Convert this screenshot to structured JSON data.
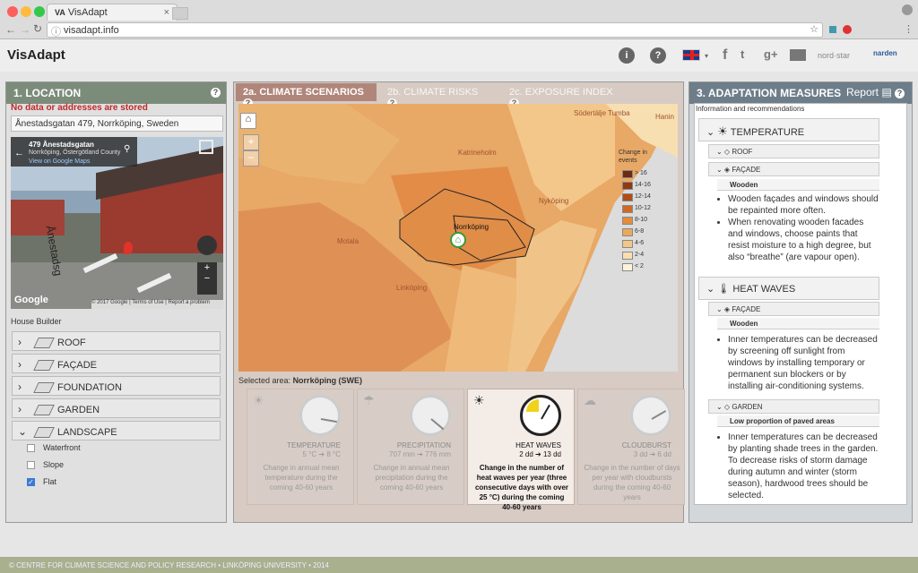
{
  "browser": {
    "tab_title": "VisAdapt",
    "url": "visadapt.info"
  },
  "header": {
    "logo": "VisAdapt",
    "lang": "EN",
    "social": [
      "f",
      "t",
      "g+"
    ],
    "partners": [
      "nord·star",
      "narden"
    ]
  },
  "location": {
    "title": "1. LOCATION",
    "warning": "No data or addresses are stored",
    "address": "Ånestadsgatan 479, Norrköping, Sweden",
    "streetview": {
      "street": "479 Ånestadsgatan",
      "locality": "Norrköping, Östergötland County",
      "link": "View on Google Maps",
      "road_label": "Ånestadsg",
      "google": "Google",
      "copyright": "© 2017 Google",
      "terms": "Terms of Use",
      "report": "Report a problem"
    },
    "house_builder": "House Builder",
    "items": [
      {
        "label": "ROOF"
      },
      {
        "label": "FAÇADE"
      },
      {
        "label": "FOUNDATION"
      },
      {
        "label": "GARDEN"
      },
      {
        "label": "LANDSCAPE"
      }
    ],
    "landscape_options": [
      {
        "label": "Waterfront",
        "checked": false
      },
      {
        "label": "Slope",
        "checked": false
      },
      {
        "label": "Flat",
        "checked": true
      }
    ]
  },
  "tabs": [
    {
      "label": "2a. CLIMATE SCENARIOS"
    },
    {
      "label": "2b. CLIMATE RISKS"
    },
    {
      "label": "2c. EXPOSURE INDEX"
    }
  ],
  "map": {
    "places": [
      "Södertälje",
      "Tumba",
      "Hanin",
      "Katrineholm",
      "Nyköping",
      "Motala",
      "Linköping",
      "Norrköping"
    ],
    "home": "⌂",
    "zoom_in": "+",
    "zoom_out": "−",
    "legend_title": "Change in events",
    "legend": [
      {
        "label": "> 16",
        "color": "#6b2a12"
      },
      {
        "label": "14-16",
        "color": "#8e3a14"
      },
      {
        "label": "12-14",
        "color": "#b24d16"
      },
      {
        "label": "10-12",
        "color": "#cf6a24"
      },
      {
        "label": "8-10",
        "color": "#e48b3c"
      },
      {
        "label": "6-8",
        "color": "#eca95c"
      },
      {
        "label": "4-6",
        "color": "#f4c787"
      },
      {
        "label": "2-4",
        "color": "#f8deb0"
      },
      {
        "label": "< 2",
        "color": "#fcf3dc"
      }
    ]
  },
  "selected_area": {
    "label": "Selected area:",
    "value": "Norrköping (SWE)"
  },
  "gauges": [
    {
      "title": "TEMPERATURE",
      "value": "5 °C ➔ 8 °C",
      "desc": "Change in annual mean temperature during the coming 40-60 years",
      "active": false
    },
    {
      "title": "PRECIPITATION",
      "value": "707 mm ➔ 776 mm",
      "desc": "Change in annual mean precipitation during the coming 40-60 years",
      "active": false
    },
    {
      "title": "HEAT WAVES",
      "value": "2 dd ➔ 13 dd",
      "desc": "Change in the number of heat waves per year (three consecutive days with over 25 °C) during the coming 40-60 years",
      "active": true
    },
    {
      "title": "CLOUDBURST",
      "value": "3 dd ➔ 6 dd",
      "desc": "Change in the number of days per year with cloudbursts during the coming 40-60 years",
      "active": false
    }
  ],
  "adaptation": {
    "title": "3. ADAPTATION MEASURES",
    "report": "Report",
    "subtitle": "Information and recommendations",
    "temperature": {
      "label": "TEMPERATURE",
      "roof": "ROOF",
      "facade": "FAÇADE",
      "material": "Wooden",
      "bullets": [
        "Wooden façades and windows should be repainted more often.",
        "When renovating wooden facades and windows, choose paints that resist moisture to a high degree, but also “breathe” (are vapour open)."
      ]
    },
    "heatwaves": {
      "label": "HEAT WAVES",
      "facade": "FAÇADE",
      "material": "Wooden",
      "bullets": [
        "Inner temperatures can be decreased by screening off sunlight from windows by installing temporary or permanent sun blockers or by installing air-conditioning systems."
      ],
      "garden": "GARDEN",
      "garden_sub": "Low proportion of paved areas",
      "garden_bullets": [
        "Inner temperatures can be decreased by planting shade trees in the garden. To decrease risks of storm damage during autumn and winter (storm season), hardwood trees should be selected."
      ]
    }
  },
  "footer": "© CENTRE FOR CLIMATE SCIENCE AND POLICY RESEARCH • LINKÖPING UNIVERSITY • 2014"
}
